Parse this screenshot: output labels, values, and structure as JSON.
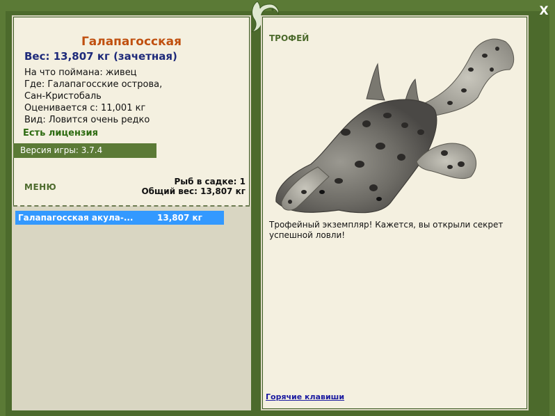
{
  "fish": {
    "name": "Галапагосская",
    "weight_line": "Вес: 13,807 кг (зачетная)",
    "details": [
      "На что поймана: живец",
      "Где: Галапагосские острова,",
      "Сан-Кристобаль",
      "Оценивается с: 11,001 кг",
      "Вид: Ловится очень редко"
    ],
    "license": "Есть лицензия"
  },
  "version": "Версия игры: 3.7.4",
  "menu_label": "МЕНЮ",
  "stats": {
    "count_line": "Рыб в садке: 1",
    "total_line": "Общий вес: 13,807 кг"
  },
  "catch_list": [
    {
      "name": "Галапагосская акула-...",
      "weight": "13,807 кг"
    }
  ],
  "trophy": {
    "label": "ТРОФЕЙ",
    "text": "Трофейный экземпляр! Кажется, вы открыли секрет успешной ловли!"
  },
  "hotkeys_label": "Горячие клавиши",
  "close_label": "X",
  "colors": {
    "frame": "#5b7a36",
    "panel": "#f4f0e0",
    "fish_name": "#c05010",
    "weight": "#1e2a7a",
    "selected_row": "#3399ff"
  }
}
